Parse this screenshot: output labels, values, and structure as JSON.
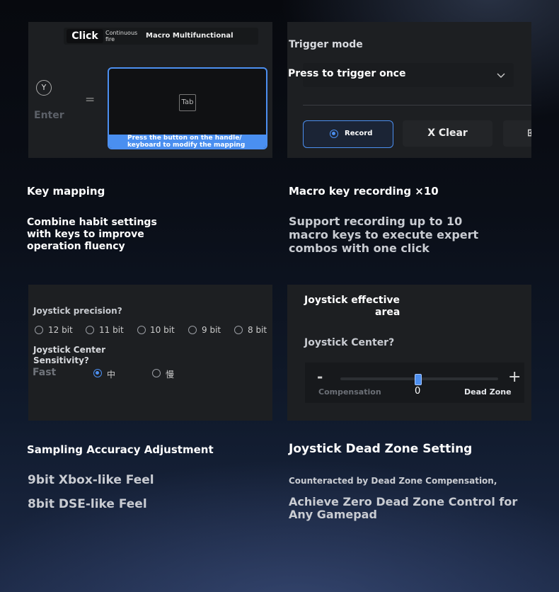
{
  "mapping_panel": {
    "tab_click": "Click",
    "tab_continuous": "Continuous",
    "tab_fire": "fire",
    "tab_macro": "Macro Multifunctional",
    "y_button": "Y",
    "enter_label": "Enter",
    "equals": "=",
    "tab_key": "Tab",
    "hint_line1": "Press the button on the handle/",
    "hint_line2": "keyboard to modify the mapping"
  },
  "macro_panel": {
    "trigger_mode_label": "Trigger mode",
    "trigger_value": "Press to trigger once",
    "record_label": "Record",
    "clear_label": "X Clear",
    "extra_glyph": "⊞"
  },
  "feature1": {
    "title": "Key mapping",
    "desc_lines": [
      "Combine habit settings",
      "with keys to improve",
      "operation fluency"
    ]
  },
  "feature2": {
    "title": "Macro key recording ×10",
    "desc_lines": [
      "Support recording up to 10",
      "macro keys to execute expert",
      "combos with one click"
    ]
  },
  "precision_panel": {
    "precision_label": "Joystick precision?",
    "options": [
      "12 bit",
      "11 bit",
      "10 bit",
      "9 bit",
      "8 bit"
    ],
    "center_label_line1": "Joystick Center",
    "center_label_line2": "Sensitivity?",
    "fast_label": "Fast",
    "center_opt_mid": "中",
    "center_opt_slow": "慢"
  },
  "deadzone_panel": {
    "effective_area_line1": "Joystick effective",
    "effective_area_line2": "area",
    "center_label": "Joystick Center?",
    "minus": "-",
    "plus": "+",
    "compensation_label": "Compensation",
    "value": "0",
    "deadzone_label": "Dead Zone",
    "slider_value": 0
  },
  "feature3": {
    "title": "Sampling Accuracy Adjustment",
    "line1": "9bit Xbox-like Feel",
    "line2": "8bit DSE-like Feel"
  },
  "feature4": {
    "title": "Joystick Dead Zone Setting",
    "line1": "Counteracted by Dead Zone Compensation,",
    "line2": "Achieve Zero Dead Zone Control for",
    "line3": "Any Gamepad"
  },
  "colors": {
    "accent": "#4c8ff0",
    "panel": "#1d1f22"
  }
}
